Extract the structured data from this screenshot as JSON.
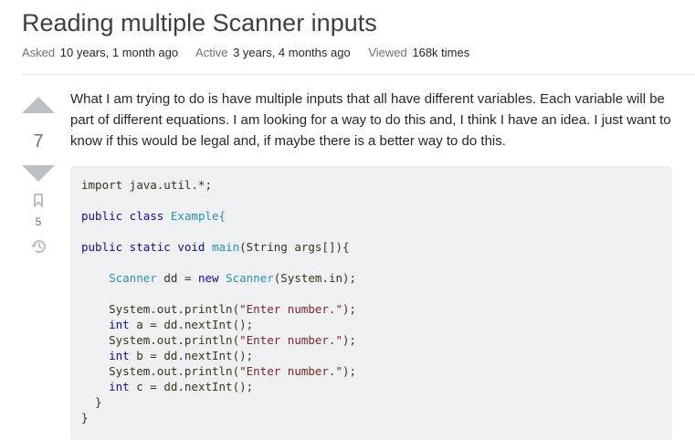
{
  "question": {
    "title": "Reading multiple Scanner inputs",
    "meta": {
      "asked_label": "Asked",
      "asked_value": "10 years, 1 month ago",
      "active_label": "Active",
      "active_value": "3 years, 4 months ago",
      "viewed_label": "Viewed",
      "viewed_value": "168k times"
    },
    "votes": "7",
    "bookmarks": "5",
    "body": "What I am trying to do is have multiple inputs that all have different variables. Each variable will be part of different equations. I am looking for a way to do this and, I think I have an idea. I just want to know if this would be legal and, if maybe there is a better way to do this.",
    "code": {
      "line1": "import java.util.*;",
      "line2_kw": "public class",
      "line2_name": "Example{",
      "line3_kw": "public static void",
      "line3_name": "main",
      "line3_rest": "(String args[]){",
      "line4_type": "Scanner",
      "line4_mid": "dd =",
      "line4_kw": "new",
      "line4_type2": "Scanner",
      "line4_rest": "(System.in);",
      "p1_pre": "System.out.println(",
      "p1_str": "\"Enter number.\"",
      "p1_post": ");",
      "a_kw": "int",
      "a_rest": "a = dd.nextInt();",
      "p2_pre": "System.out.println(",
      "p2_str": "\"Enter number.\"",
      "p2_post": ");",
      "b_kw": "int",
      "b_rest": "b = dd.nextInt();",
      "p3_pre": "System.out.println(",
      "p3_str": "\"Enter number.\"",
      "p3_post": ");",
      "c_kw": "int",
      "c_rest": "c = dd.nextInt();",
      "close1": "  }",
      "close2": "}"
    }
  },
  "icons": {
    "vote_up": "arrow-up-icon",
    "vote_down": "arrow-down-icon",
    "bookmark": "bookmark-icon",
    "history": "history-icon"
  },
  "colors": {
    "vote_arrow": "#bbc0c4",
    "code_bg": "#eff0f1"
  }
}
